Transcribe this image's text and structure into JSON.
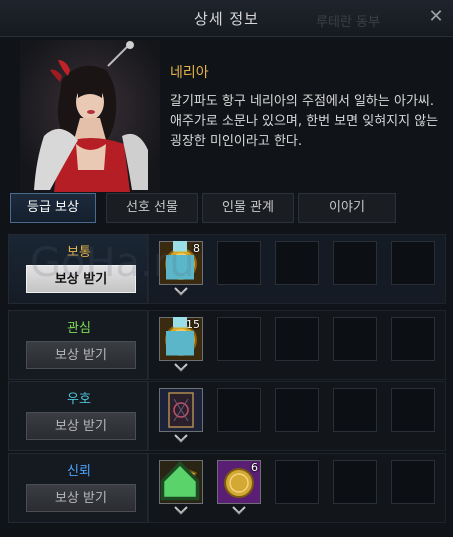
{
  "window": {
    "title": "상세 정보",
    "title_ghost": "루테란 동부",
    "close_icon": "✕"
  },
  "character": {
    "name": "네리아",
    "description": "갈기파도 항구 네리아의 주점에서 일하는 아가씨. 애주가로 소문나 있으며, 한번 보면 잊혀지지 않는 굉장한 미인이라고 한다."
  },
  "tabs": [
    {
      "label": "등급 보상",
      "active": true
    },
    {
      "label": "선호 선물",
      "active": false
    },
    {
      "label": "인물 관계",
      "active": false
    },
    {
      "label": "이야기",
      "active": false
    }
  ],
  "rewards": [
    {
      "tier": "보통",
      "tier_color": "#e6b34b",
      "button": "보상 받기",
      "active": true,
      "items": [
        {
          "icon": "gold-coin-icon",
          "count": "8",
          "badge": "potion-badge-icon"
        }
      ]
    },
    {
      "tier": "관심",
      "tier_color": "#7ed957",
      "button": "보상 받기",
      "active": false,
      "items": [
        {
          "icon": "gold-coin-icon",
          "count": "15",
          "badge": "potion-badge-icon"
        }
      ]
    },
    {
      "tier": "우호",
      "tier_color": "#4fc3d9",
      "button": "보상 받기",
      "active": false,
      "items": [
        {
          "icon": "card-icon",
          "count": "",
          "badge": ""
        }
      ]
    },
    {
      "tier": "신뢰",
      "tier_color": "#4aa3ff",
      "button": "보상 받기",
      "active": false,
      "items": [
        {
          "icon": "scroll-map-icon",
          "count": "",
          "badge": "house-badge-icon"
        },
        {
          "icon": "purple-coin-icon",
          "count": "6",
          "badge": ""
        }
      ]
    }
  ],
  "watermark": "GoHa.ru  Gamesonline.ru",
  "colors": {
    "accent_tab": "#4a6a8e",
    "gold": "#e6b34b",
    "purple": "#8a3fb0"
  }
}
